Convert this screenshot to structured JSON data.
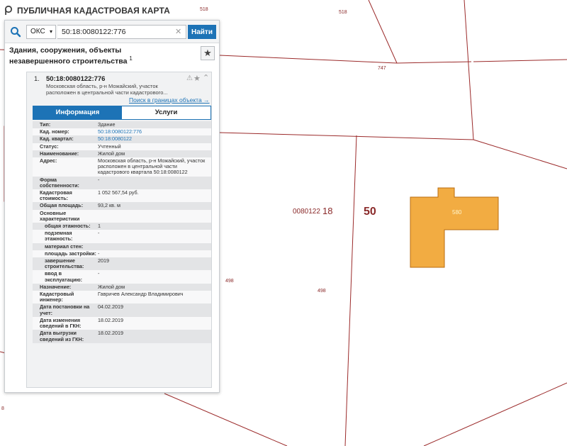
{
  "app": {
    "title": "ПУБЛИЧНАЯ КАДАСТРОВАЯ КАРТА"
  },
  "search": {
    "type_label": "ОКС",
    "query": "50:18:0080122:776",
    "button_label": "Найти"
  },
  "panel": {
    "category_title": "Здания, сооружения, объекты незавершенного строительства",
    "category_count": "1"
  },
  "result": {
    "index": "1.",
    "cadastral_number": "50:18:0080122:776",
    "address_short": "Московская область, р-н Можайский, участок расположен в центральной части кадастрового...",
    "search_in_bounds": "Поиск в границах объекта →",
    "tabs": {
      "info": "Информация",
      "services": "Услуги"
    },
    "attributes": [
      {
        "k": "Тип:",
        "v": "Здание"
      },
      {
        "k": "Кад. номер:",
        "v": "50:18:0080122:776"
      },
      {
        "k": "Кад. квартал:",
        "v": "50:18:0080122"
      },
      {
        "k": "Статус:",
        "v": "Учтенный"
      },
      {
        "k": "Наименование:",
        "v": "Жилой дом"
      },
      {
        "k": "Адрес:",
        "v": "Московская область, р-н Можайский, участок расположен в центральной части кадастрового квартала 50:18:0080122"
      },
      {
        "k": "Форма собственности:",
        "v": "-"
      },
      {
        "k": "Кадастровая стоимость:",
        "v": "1 052 567,54 руб."
      },
      {
        "k": "Общая площадь:",
        "v": "93,2 кв. м"
      },
      {
        "k": "Основные характеристики",
        "v": ""
      },
      {
        "k": "общая этажность:",
        "v": "1"
      },
      {
        "k": "подземная этажность:",
        "v": "-"
      },
      {
        "k": "материал стен:",
        "v": ""
      },
      {
        "k": "площадь застройки:",
        "v": "-"
      },
      {
        "k": "завершение строительства:",
        "v": "2019"
      },
      {
        "k": "ввод в эксплуатацию:",
        "v": "-"
      },
      {
        "k": "Назначение:",
        "v": "Жилой дом"
      },
      {
        "k": "Кадастровый инженер:",
        "v": "Гавричев Александр Владимирович"
      },
      {
        "k": "Дата постановки на учет:",
        "v": "04.02.2019"
      },
      {
        "k": "Дата изменения сведений в ГКН:",
        "v": "18.02.2019"
      },
      {
        "k": "Дата выгрузки сведений из ГКН:",
        "v": "18.02.2019"
      }
    ]
  },
  "map": {
    "labels": {
      "l518a": "518",
      "l518b": "518",
      "l747": "747",
      "l498a": "498",
      "l498b": "498",
      "l8": "8",
      "quarter": "0080122",
      "q18": "18",
      "q50": "50",
      "building": "580"
    },
    "colors": {
      "building_fill": "#f2ac42",
      "building_stroke": "#b96c10",
      "pink_fill": "#f27b7b",
      "lines": "#9b2a2a"
    }
  }
}
